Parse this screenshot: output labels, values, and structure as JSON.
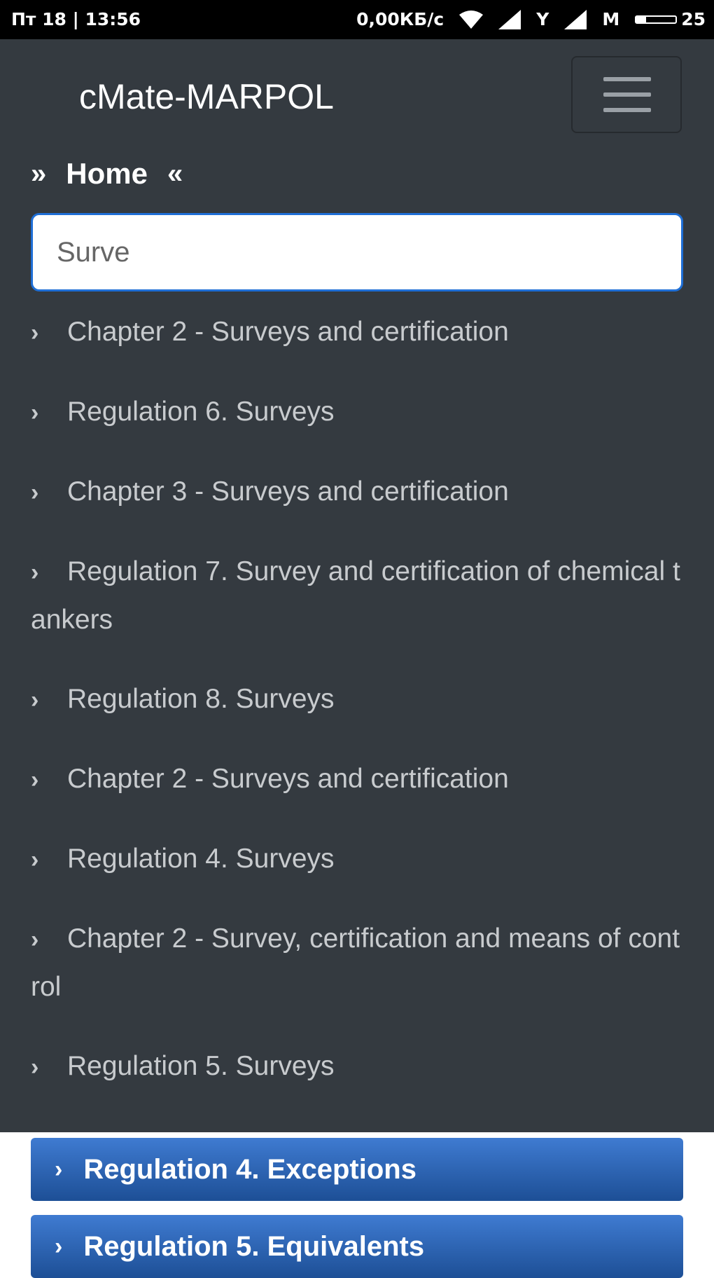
{
  "status_bar": {
    "time": "Пт 18 | 13:56",
    "network_speed": "0,00КБ/с",
    "sim1_label": "Y",
    "sim2_label": "M",
    "battery_level": "25",
    "battery_fill": 0.25
  },
  "header": {
    "brand": "cMate-MARPOL",
    "menu_icon": "hamburger-menu-icon"
  },
  "breadcrumb": {
    "left_chevron": "»",
    "label": "Home",
    "right_chevron": "«"
  },
  "search": {
    "value": "Surve",
    "placeholder": ""
  },
  "results": [
    {
      "label": "Chapter 2 - Surveys and certification"
    },
    {
      "label": "Regulation 6. Surveys"
    },
    {
      "label": "Chapter 3 - Surveys and certification"
    },
    {
      "label": "Regulation 7. Survey and certification of chemical tankers"
    },
    {
      "label": "Regulation 8. Surveys"
    },
    {
      "label": "Chapter 2 - Surveys and certification"
    },
    {
      "label": "Regulation 4. Surveys"
    },
    {
      "label": "Chapter 2 - Survey, certification and means of control"
    },
    {
      "label": "Regulation 5. Surveys"
    }
  ],
  "sections": [
    {
      "label": "Regulation 4. Exceptions"
    },
    {
      "label": "Regulation 5. Equivalents"
    }
  ],
  "colors": {
    "navbar_bg": "#343a40",
    "search_border": "#1f6fd6",
    "section_bg": "#2a63b4"
  }
}
